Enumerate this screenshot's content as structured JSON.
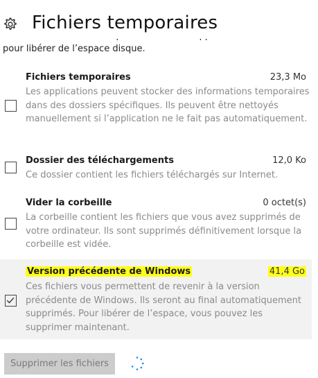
{
  "header": {
    "title": "Fichiers temporaires",
    "icon": "gear-icon"
  },
  "intro": {
    "text": "Choisissez les éléments que vous voulez supprimer définitivement pour libérer de l’espace disque."
  },
  "items": [
    {
      "title": "Fichiers temporaires",
      "size": "23,3 Mo",
      "description": "Les applications peuvent stocker des informations temporaires dans des dossiers spécifiques. Ils peuvent être nettoyés manuellement si l’application ne le fait pas automatiquement.",
      "checked": false
    },
    {
      "title": "Dossier des téléchargements",
      "size": "12,0 Ko",
      "description": "Ce dossier contient les fichiers téléchargés sur Internet.",
      "checked": false
    },
    {
      "title": "Vider la corbeille",
      "size": "0 octet(s)",
      "description": "La corbeille contient les fichiers que vous avez supprimés de votre ordinateur. Ils sont supprimés définitivement lorsque la corbeille est vidée.",
      "checked": false
    },
    {
      "title": "Version précédente de Windows",
      "size": "41,4 Go",
      "description": "Ces fichiers vous permettent de revenir à la version précédente de Windows. Ils seront au final automatiquement supprimés. Pour libérer de l’espace, vous pouvez les supprimer maintenant.",
      "checked": true
    }
  ],
  "actions": {
    "delete_label": "Supprimer les fichiers"
  },
  "colors": {
    "highlight": "#ffff1a",
    "selected_background": "#f2f2f2",
    "button_background": "#cccccc",
    "spinner": "#1e88e5"
  }
}
